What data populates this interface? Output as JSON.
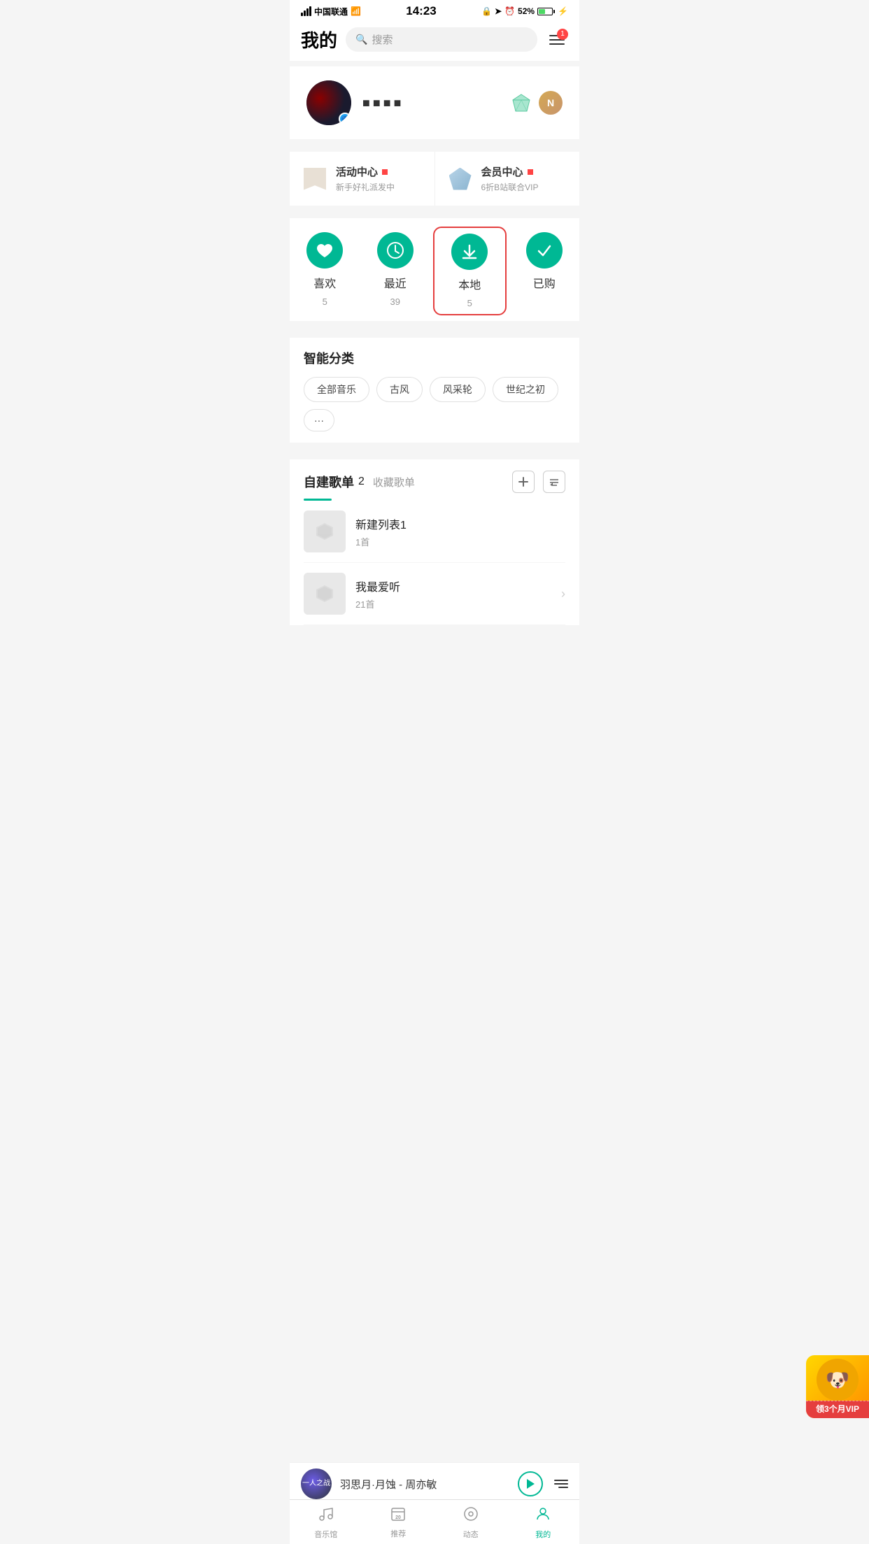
{
  "statusBar": {
    "carrier": "中国联通",
    "time": "14:23",
    "battery": "52%"
  },
  "header": {
    "title": "我的",
    "searchPlaceholder": "搜索",
    "menuBadge": "1"
  },
  "profile": {
    "name": "■■■■",
    "avatarBg": "#1a1a2e"
  },
  "activityCenter": {
    "label": "活动中心",
    "sub": "新手好礼派发中"
  },
  "memberCenter": {
    "label": "会员中心",
    "sub": "6折B站联合VIP"
  },
  "quickAccess": [
    {
      "id": "like",
      "icon": "♥",
      "label": "喜欢",
      "count": "5"
    },
    {
      "id": "recent",
      "icon": "◷",
      "label": "最近",
      "count": "39"
    },
    {
      "id": "local",
      "icon": "↓",
      "label": "本地",
      "count": "5",
      "active": true
    },
    {
      "id": "purchased",
      "icon": "✓",
      "label": "已购",
      "count": ""
    }
  ],
  "smartCategories": {
    "title": "智能分类",
    "tags": [
      "全部音乐",
      "古风",
      "风采轮",
      "世纪之初",
      "···"
    ]
  },
  "playlists": {
    "sectionTitle": "自建歌单",
    "count": "2",
    "collectionTab": "收藏歌单",
    "items": [
      {
        "name": "新建列表1",
        "songs": "1首"
      },
      {
        "name": "我最爱听",
        "songs": "21首"
      }
    ]
  },
  "vipBanner": {
    "text": "领3个月VIP"
  },
  "nowPlaying": {
    "title": "羽思月·月蚀 - 周亦敏",
    "thumb": "一人之战"
  },
  "tabBar": {
    "items": [
      {
        "id": "music",
        "icon": "♪",
        "label": "音乐馆"
      },
      {
        "id": "recommend",
        "icon": "📅",
        "label": "推荐",
        "badge": "20"
      },
      {
        "id": "dynamic",
        "icon": "◎",
        "label": "动态"
      },
      {
        "id": "mine",
        "icon": "👤",
        "label": "我的",
        "active": true
      }
    ]
  }
}
